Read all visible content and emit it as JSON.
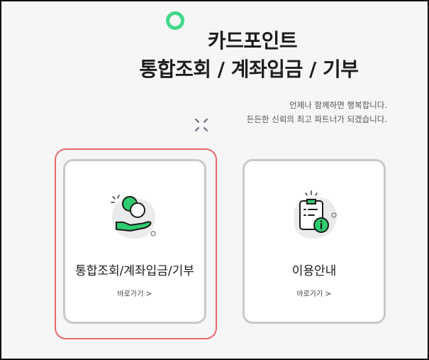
{
  "header": {
    "title_line1": "카드포인트",
    "title_line2": "통합조회 / 계좌입금 / 기부",
    "subtitle_line1": "언제나 함께하면 행복합니다.",
    "subtitle_line2": "든든한 신뢰의 최고 파트너가 되겠습니다."
  },
  "cards": [
    {
      "title": "통합조회/계좌입금/기부",
      "link_label": "바로가기",
      "link_chevron": ">",
      "icon": "coin-hand-icon"
    },
    {
      "title": "이용안내",
      "link_label": "바로가기",
      "link_chevron": ">",
      "icon": "clipboard-info-icon"
    }
  ],
  "colors": {
    "accent_green": "#43d88a",
    "highlight_red": "#e8686b",
    "card_border": "#c9c9c9"
  }
}
